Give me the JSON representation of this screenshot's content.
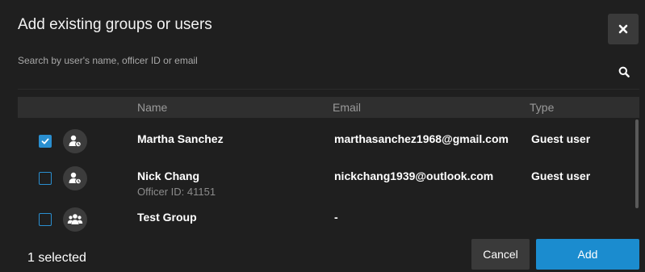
{
  "dialog": {
    "title": "Add existing groups or users",
    "close_icon": "close-icon"
  },
  "search": {
    "placeholder": "Search by user's name, officer ID or email",
    "value": "",
    "icon": "search-icon"
  },
  "table": {
    "columns": {
      "name": "Name",
      "email": "Email",
      "type": "Type"
    },
    "rows": [
      {
        "checked": true,
        "avatar_icon": "guest-user-icon",
        "name": "Martha Sanchez",
        "sub": "",
        "email": "marthasanchez1968@gmail.com",
        "type": "Guest user"
      },
      {
        "checked": false,
        "avatar_icon": "guest-user-icon",
        "name": "Nick Chang",
        "sub": "Officer ID: 41151",
        "email": "nickchang1939@outlook.com",
        "type": "Guest user"
      },
      {
        "checked": false,
        "avatar_icon": "group-icon",
        "name": "Test Group",
        "sub": "",
        "email": "-",
        "type": ""
      }
    ]
  },
  "footer": {
    "selected_text": "1 selected",
    "cancel_label": "Cancel",
    "add_label": "Add"
  },
  "colors": {
    "accent": "#1b8ccf",
    "background": "#1f1f1f",
    "header_bg": "#2f2f2f"
  }
}
